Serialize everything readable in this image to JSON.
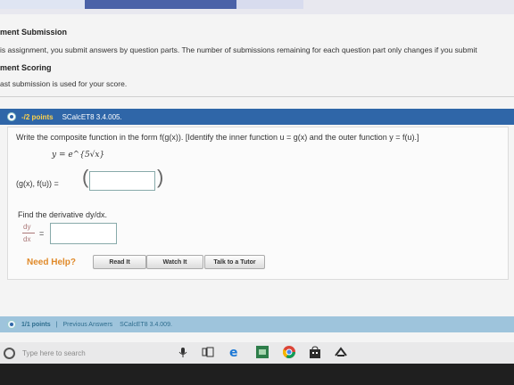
{
  "info": {
    "submission_heading": "ment Submission",
    "submission_text": "is assignment, you submit answers by question parts. The number of submissions remaining for each question part only changes if you submit",
    "scoring_heading": "ment Scoring",
    "scoring_text": "ast submission is used for your score."
  },
  "question": {
    "points": "-/2 points",
    "id": "SCalcET8 3.4.005.",
    "prompt": "Write the composite function in the form f(g(x)).  [Identify the inner function  u = g(x)  and the outer function  y = f(u).]",
    "equation": "y = e^{5√x}",
    "pair_label": "(g(x), f(u)) =",
    "pair_value": "",
    "derivative_prompt": "Find the derivative dy/dx.",
    "derivative_num": "dy",
    "derivative_den": "dx",
    "derivative_eq": "=",
    "derivative_value": ""
  },
  "help": {
    "label": "Need Help?",
    "read_it": "Read It",
    "watch_it": "Watch It",
    "talk_to_tutor": "Talk to a Tutor"
  },
  "next_question": {
    "points": "1/1 points",
    "separator": "|",
    "previous_answers": "Previous Answers",
    "id": "SCalcET8 3.4.009."
  },
  "taskbar": {
    "search_placeholder": "Type here to search"
  },
  "colors": {
    "header_blue": "#2f66a8",
    "points_yellow": "#ffd24a",
    "need_help_orange": "#e08a2a",
    "next_header": "#9ec4dc"
  }
}
